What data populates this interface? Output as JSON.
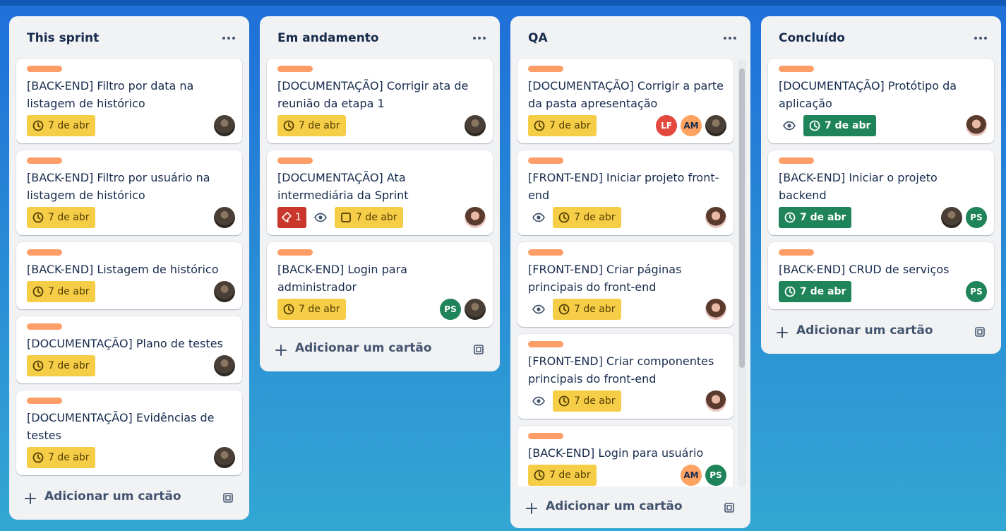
{
  "lists": [
    {
      "title": "This sprint",
      "cards": [
        {
          "title": "[BACK-END] Filtro por data na listagem de histórico",
          "due": "7 de abr",
          "members": [
            "man"
          ]
        },
        {
          "title": "[BACK-END] Filtro por usuário na listagem de histórico",
          "due": "7 de abr",
          "members": [
            "man"
          ]
        },
        {
          "title": "[BACK-END] Listagem de histórico",
          "due": "7 de abr",
          "members": [
            "man"
          ]
        },
        {
          "title": "[DOCUMENTAÇÃO] Plano de testes",
          "due": "7 de abr",
          "members": [
            "man"
          ]
        },
        {
          "title": "[DOCUMENTAÇÃO] Evidências de testes",
          "due": "7 de abr",
          "members": [
            "man"
          ]
        }
      ],
      "add_label": "Adicionar um cartão"
    },
    {
      "title": "Em andamento",
      "cards": [
        {
          "title": "[DOCUMENTAÇÃO] Corrigir ata de reunião da etapa 1",
          "due": "7 de abr",
          "members": [
            "man"
          ]
        },
        {
          "title": "[DOCUMENTAÇÃO] Ata intermediária da Sprint",
          "comments": "1",
          "due": "7 de abr",
          "members": [
            "woman"
          ]
        },
        {
          "title": "[BACK-END] Login para administrador",
          "due": "7 de abr",
          "members": [
            "PS",
            "man"
          ]
        }
      ],
      "add_label": "Adicionar um cartão"
    },
    {
      "title": "QA",
      "cards": [
        {
          "title": "[DOCUMENTAÇÃO] Corrigir a parte da pasta apresentação",
          "due": "7 de abr",
          "members": [
            "LF",
            "AM",
            "man"
          ]
        },
        {
          "title": "[FRONT-END] Iniciar projeto front-end",
          "due": "7 de abr",
          "members": [
            "woman"
          ]
        },
        {
          "title": "[FRONT-END] Criar páginas principais do front-end",
          "due": "7 de abr",
          "members": [
            "woman"
          ]
        },
        {
          "title": "[FRONT-END] Criar componentes principais do front-end",
          "due": "7 de abr",
          "members": [
            "woman"
          ]
        },
        {
          "title": "[BACK-END] Login para usuário",
          "due": "7 de abr",
          "members": [
            "AM",
            "PS"
          ]
        }
      ],
      "add_label": "Adicionar um cartão"
    },
    {
      "title": "Concluído",
      "cards": [
        {
          "title": "[DOCUMENTAÇÃO] Protótipo da aplicação",
          "due": "7 de abr",
          "members": [
            "woman"
          ]
        },
        {
          "title": "[BACK-END] Iniciar o projeto backend",
          "due": "7 de abr",
          "members": [
            "man",
            "PS"
          ]
        },
        {
          "title": "[BACK-END] CRUD de serviços",
          "due": "7 de abr",
          "members": [
            "PS"
          ]
        }
      ],
      "add_label": "Adicionar um cartão"
    }
  ],
  "colors": {
    "label": "#fd9e68",
    "due_pending": "#f5cd47",
    "due_complete": "#1f845a",
    "comment_badge": "#c9372c",
    "avatar_ps": "#1f845a",
    "avatar_lf": "#e2483d",
    "avatar_am": "#fea362"
  },
  "icons": [
    "clock-icon",
    "eye-icon",
    "comment-icon",
    "checkbox-icon",
    "plus-icon",
    "template-icon",
    "more-icon"
  ]
}
